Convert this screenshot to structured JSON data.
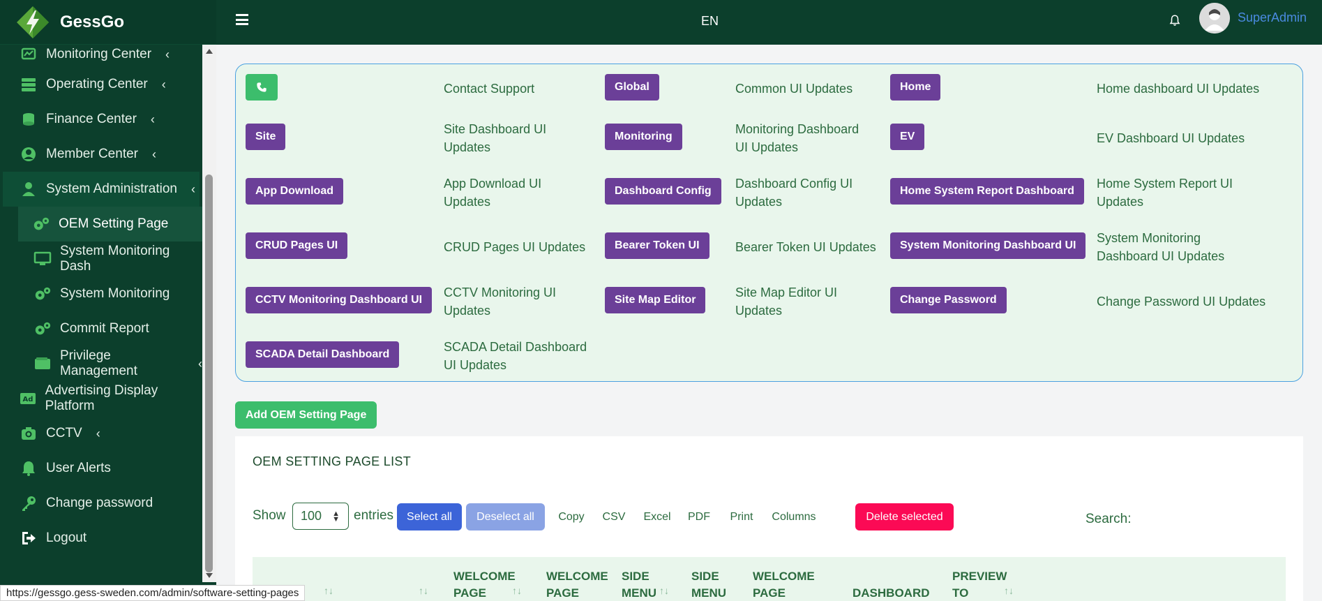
{
  "brand": {
    "name": "GessGo"
  },
  "header": {
    "language": "EN",
    "username": "SuperAdmin"
  },
  "sidebar": {
    "items": [
      {
        "label": "Monitoring Center",
        "icon": "monitoring-icon",
        "chevron": true
      },
      {
        "label": "Operating Center",
        "icon": "server-icon",
        "chevron": true
      },
      {
        "label": "Finance Center",
        "icon": "coins-icon",
        "chevron": true
      },
      {
        "label": "Member Center",
        "icon": "user-circle-icon",
        "chevron": true
      },
      {
        "label": "System Administration",
        "icon": "admin-icon",
        "chevron": true
      },
      {
        "label": "OEM Setting Page",
        "icon": "gears-icon",
        "sub": true
      },
      {
        "label": "System Monitoring Dash",
        "icon": "desktop-icon",
        "sub": true
      },
      {
        "label": "System Monitoring",
        "icon": "gears-icon",
        "sub": true
      },
      {
        "label": "Commit Report",
        "icon": "gears-icon",
        "sub": true
      },
      {
        "label": "Privilege Management",
        "icon": "wallet-icon",
        "sub": true,
        "chevron": true
      },
      {
        "label": "Advertising Display Platform",
        "icon": "ad-icon"
      },
      {
        "label": "CCTV",
        "icon": "camera-icon",
        "chevron": true
      },
      {
        "label": "User Alerts",
        "icon": "bell-icon"
      },
      {
        "label": "Change password",
        "icon": "key-icon"
      },
      {
        "label": "Logout",
        "icon": "logout-icon"
      }
    ]
  },
  "panel": {
    "rows": [
      [
        {
          "btn": "",
          "text": "Contact Support"
        },
        {
          "btn": "Global",
          "text": "Common UI Updates"
        },
        {
          "btn": "Home",
          "text": "Home dashboard UI Updates"
        }
      ],
      [
        {
          "btn": "Site",
          "text": "Site Dashboard UI Updates"
        },
        {
          "btn": "Monitoring",
          "text": "Monitoring Dashboard UI Updates"
        },
        {
          "btn": "EV",
          "text": "EV Dashboard UI Updates"
        }
      ],
      [
        {
          "btn": "App Download",
          "text": "App Download UI Updates"
        },
        {
          "btn": "Dashboard Config",
          "text": "Dashboard Config UI Updates"
        },
        {
          "btn": "Home System Report Dashboard",
          "text": "Home System Report UI Updates"
        }
      ],
      [
        {
          "btn": "CRUD Pages UI",
          "text": "CRUD Pages UI Updates"
        },
        {
          "btn": "Bearer Token UI",
          "text": "Bearer Token UI Updates"
        },
        {
          "btn": "System Monitoring Dashboard UI",
          "text": "System Monitoring Dashboard UI Updates"
        }
      ],
      [
        {
          "btn": "CCTV Monitoring Dashboard UI",
          "text": "CCTV Monitoring UI Updates"
        },
        {
          "btn": "Site Map Editor",
          "text": "Site Map Editor UI Updates"
        },
        {
          "btn": "Change Password",
          "text": "Change Password UI Updates"
        }
      ],
      [
        {
          "btn": "SCADA Detail Dashboard",
          "text": "SCADA Detail Dashboard UI Updates"
        }
      ]
    ]
  },
  "add_button": "Add OEM Setting Page",
  "list": {
    "title": "OEM SETTING PAGE LIST",
    "show_label": "Show",
    "entries_value": "100",
    "entries_label": "entries",
    "buttons": {
      "select_all": "Select all",
      "deselect_all": "Deselect all",
      "copy": "Copy",
      "csv": "CSV",
      "excel": "Excel",
      "pdf": "PDF",
      "print": "Print",
      "columns": "Columns",
      "delete_selected": "Delete selected"
    },
    "search_label": "Search:",
    "columns": [
      "WELCOME PAGE",
      "WELCOME PAGE",
      "SIDE MENU",
      "SIDE MENU",
      "WELCOME PAGE",
      "DASHBOARD",
      "PREVIEW TO"
    ]
  },
  "status_url": "https://gessgo.gess-sweden.com/admin/software-setting-pages",
  "colors": {
    "primary_dark": "#0c3f2c",
    "purple": "#6b3f98",
    "green": "#3cbd6c",
    "danger": "#fb0a55",
    "blue": "#3c64d8"
  }
}
